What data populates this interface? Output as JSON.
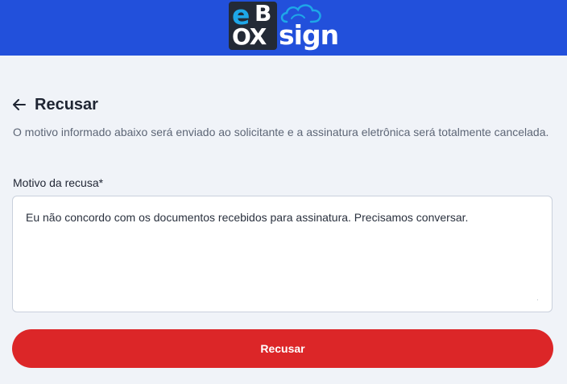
{
  "header": {
    "logo": {
      "letter_e": "e",
      "letter_b": "B",
      "letters_ox": "OX",
      "word_sign": "sign"
    },
    "background_color": "#2250db"
  },
  "page": {
    "title": "Recusar",
    "description": "O motivo informado abaixo será enviado ao solicitante e a assinatura eletrônica será totalmente cancelada."
  },
  "form": {
    "reason_label": "Motivo da recusa",
    "required_marker": "*",
    "reason_value": "Eu não concordo com os documentos recebidos para assinatura. Precisamos conversar.",
    "submit_label": "Recusar"
  },
  "colors": {
    "primary_blue": "#2250db",
    "danger_red": "#dc2628",
    "logo_accent": "#1ea7e8",
    "page_background": "#f0f3f8"
  },
  "icons": {
    "back": "arrow-left-icon",
    "logo_cloud": "cloud-icon"
  }
}
